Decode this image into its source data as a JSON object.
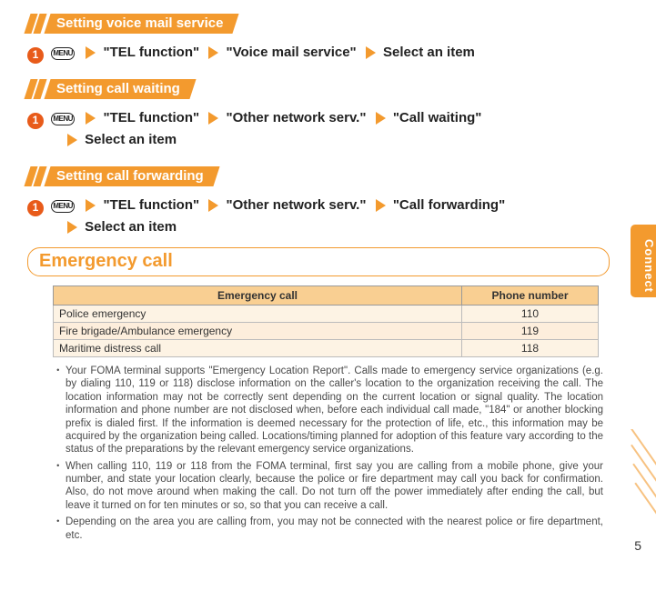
{
  "sections": {
    "voicemail": {
      "title": "Setting voice mail service",
      "menu": "MENU",
      "step1": "\"TEL function\"",
      "step2": "\"Voice mail service\"",
      "step3": "Select an item"
    },
    "callwaiting": {
      "title": "Setting call waiting",
      "menu": "MENU",
      "step1": "\"TEL function\"",
      "step2": "\"Other network serv.\"",
      "step3": "\"Call waiting\"",
      "step4": "Select an item"
    },
    "callforward": {
      "title": "Setting call forwarding",
      "menu": "MENU",
      "step1": "\"TEL function\"",
      "step2": "\"Other network serv.\"",
      "step3": "\"Call forwarding\"",
      "step4": "Select an item"
    }
  },
  "heading": "Emergency call",
  "table": {
    "headers": {
      "col1": "Emergency call",
      "col2": "Phone number"
    },
    "rows": [
      {
        "label": "Police emergency",
        "num": "110"
      },
      {
        "label": "Fire brigade/Ambulance emergency",
        "num": "119"
      },
      {
        "label": "Maritime distress call",
        "num": "118"
      }
    ]
  },
  "notes": [
    "Your FOMA terminal supports \"Emergency Location Report\". Calls made to emergency service organizations (e.g. by dialing 110, 119 or 118) disclose information on the caller's location to the organization receiving the call. The location information may not be correctly sent depending on the current location or signal quality. The location information and phone number are not disclosed when, before each individual call made, \"184\" or another blocking prefix is dialed first. If the information is deemed necessary for the protection of life, etc., this information may be acquired by the organization being called. Locations/timing planned for adoption of this feature vary according to the status of the preparations by the relevant emergency service organizations.",
    "When calling 110, 119 or 118 from the FOMA terminal, first say you are calling from a mobile phone, give your number, and state your location clearly, because the police or fire department may call you back for confirmation. Also, do not move around when making the call. Do not turn off the power immediately after ending the call, but leave it turned on for ten minutes or so, so that you can receive a call.",
    "Depending on the area you are calling from, you may not be connected with the nearest police or fire department, etc."
  ],
  "side_tab": "Connect",
  "page_number": "5"
}
